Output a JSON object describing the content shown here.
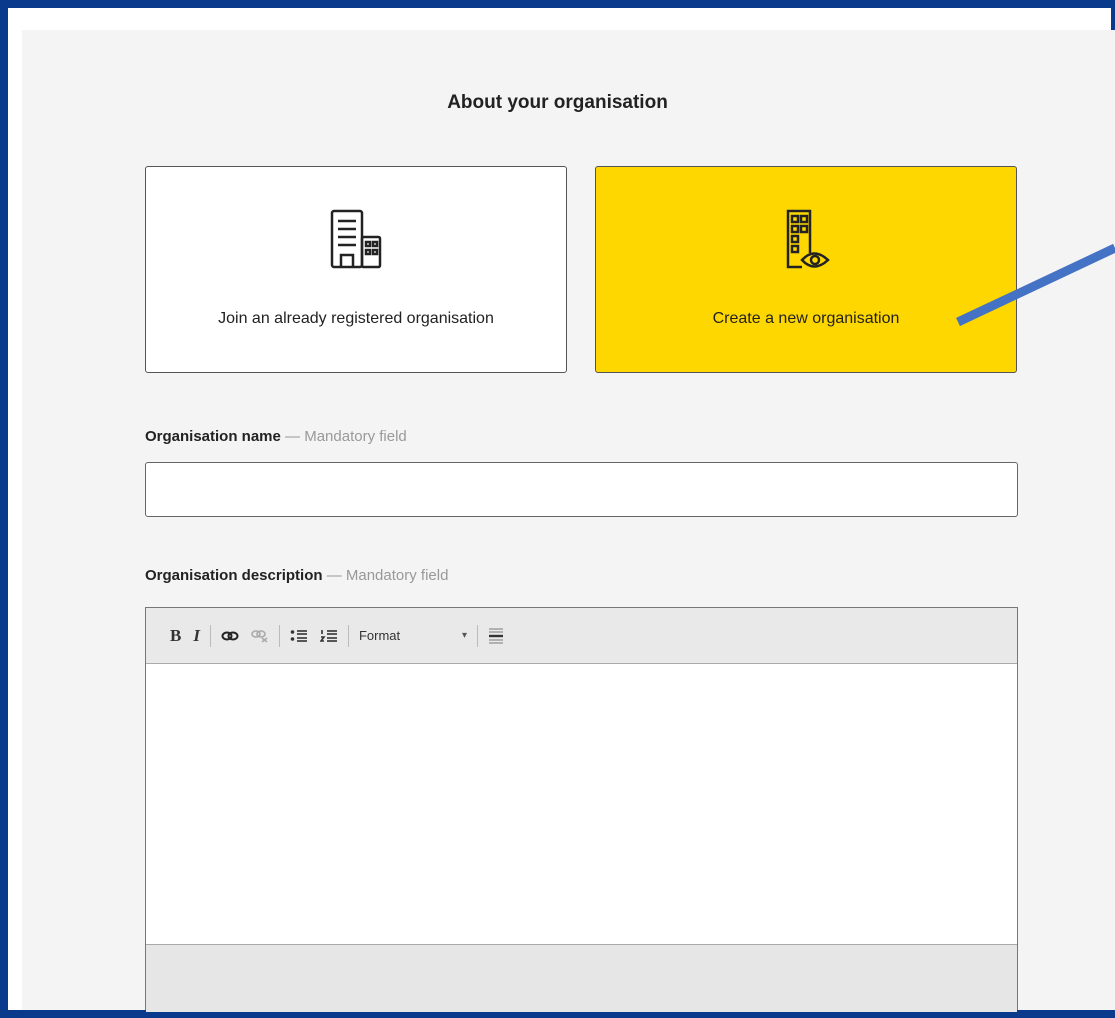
{
  "section": {
    "title": "About your organisation"
  },
  "options": [
    {
      "label": "Join an already registered organisation",
      "icon": "buildings-icon"
    },
    {
      "label": "Create a new organisation",
      "icon": "building-eye-icon",
      "selected": true
    }
  ],
  "fields": {
    "name": {
      "label": "Organisation name",
      "mandatory": "— Mandatory field",
      "value": ""
    },
    "description": {
      "label": "Organisation description",
      "mandatory": "— Mandatory field",
      "value": ""
    }
  },
  "toolbar": {
    "bold": "B",
    "italic": "I",
    "format_label": "Format",
    "format_arrow": "▾"
  },
  "colors": {
    "frame": "#0a3a8c",
    "selected_card": "#ffd700",
    "arrow": "#4472c4"
  }
}
